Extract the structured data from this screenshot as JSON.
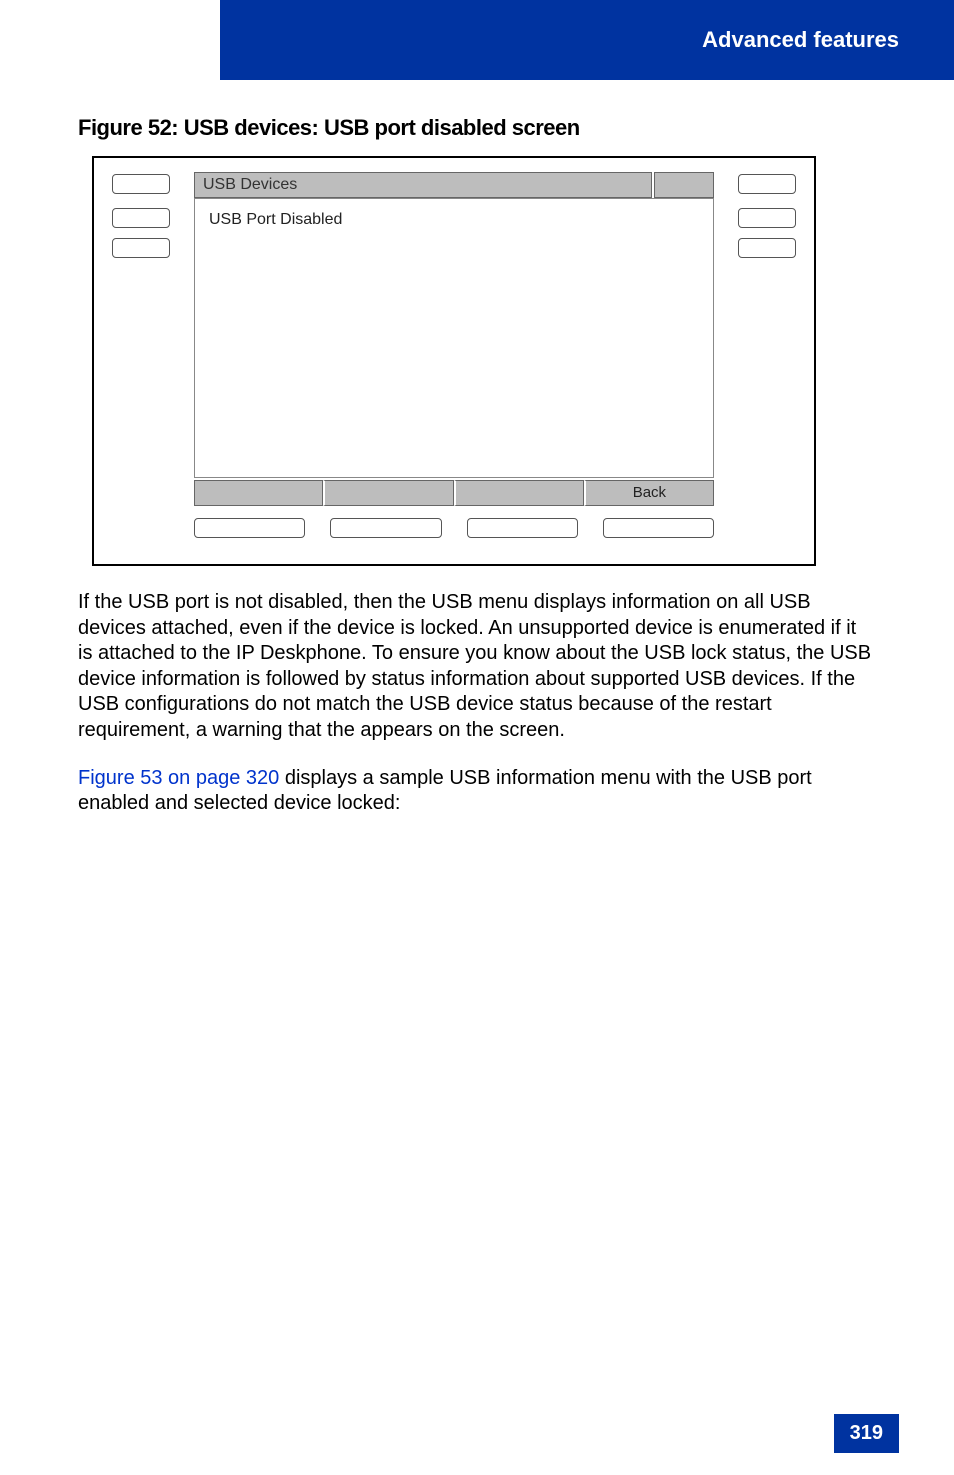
{
  "header": {
    "title": "Advanced features"
  },
  "figure": {
    "caption": "Figure 52: USB devices: USB port disabled screen",
    "screen": {
      "header_label": "USB Devices",
      "body_text": "USB Port Disabled",
      "softkeys": {
        "sk1": "",
        "sk2": "",
        "sk3": "",
        "sk4": "Back"
      }
    }
  },
  "body": {
    "p1": "If the USB port is not disabled, then the USB menu displays information on all USB devices attached, even if the device is locked. An unsupported device is enumerated if it is attached to the IP Deskphone. To ensure you know about the USB lock status, the USB device information is followed by status information about supported USB devices. If the USB configurations do not match the USB device status because of the restart requirement, a warning that the                                                       appears on the screen.",
    "p2_link": "Figure 53 on page 320",
    "p2_rest": " displays a sample USB information menu with the USB port enabled and selected device locked:"
  },
  "page_number": "319"
}
